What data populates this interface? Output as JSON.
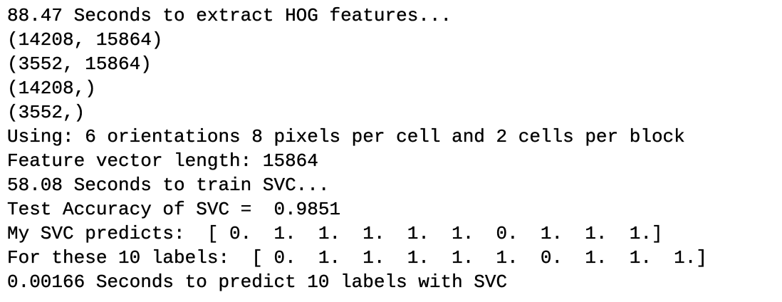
{
  "console": {
    "lines": [
      "88.47 Seconds to extract HOG features...",
      "(14208, 15864)",
      "(3552, 15864)",
      "(14208,)",
      "(3552,)",
      "Using: 6 orientations 8 pixels per cell and 2 cells per block",
      "Feature vector length: 15864",
      "58.08 Seconds to train SVC...",
      "Test Accuracy of SVC =  0.9851",
      "My SVC predicts:  [ 0.  1.  1.  1.  1.  1.  0.  1.  1.  1.]",
      "For these 10 labels:  [ 0.  1.  1.  1.  1.  1.  0.  1.  1.  1.]",
      "0.00166 Seconds to predict 10 labels with SVC"
    ]
  },
  "colors": {
    "background": "#ffffff",
    "text": "#000000"
  }
}
